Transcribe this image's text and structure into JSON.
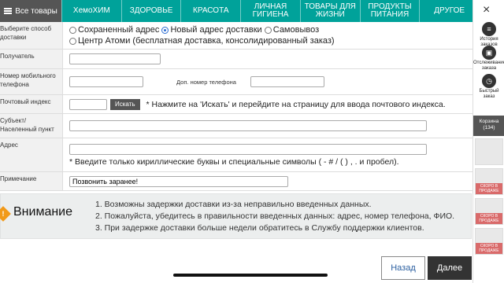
{
  "topnav": {
    "all_label": "Все товары",
    "categories": [
      "ХемоХИМ",
      "ЗДОРОВЬЕ",
      "КРАСОТА",
      "ЛИЧНАЯ ГИГИЕНА",
      "ТОВАРЫ ДЛЯ ЖИЗНИ",
      "ПРОДУКТЫ ПИТАНИЯ",
      "ДРУГОЕ"
    ]
  },
  "form": {
    "method": {
      "label": "Выберите способ доставки",
      "options": [
        "Сохраненный адрес",
        "Новый адрес доставки",
        "Самовывоз",
        "Центр Атоми (бесплатная доставка, консолидированный заказ)"
      ],
      "selected_index": 1
    },
    "recipient": {
      "label": "Получатель",
      "value": ""
    },
    "phone": {
      "label": "Номер мобильного телефона",
      "value": "",
      "extra_label": "Доп. номер телефона",
      "extra_value": ""
    },
    "postcode": {
      "label": "Почтовый индекс",
      "value": "",
      "search_label": "Искать",
      "note": "* Нажмите на 'Искать' и перейдите на страницу для ввода почтового индекса."
    },
    "locality": {
      "label": "Субъект/Населенный пункт",
      "value": ""
    },
    "address": {
      "label": "Адрес",
      "value": "",
      "note": "* Введите только кириллические буквы и специальные символы ( - # / ( ) , . и пробел)."
    },
    "comment": {
      "label": "Примечание",
      "value": "Позвонить заранее!"
    }
  },
  "attention": {
    "title": "Внимание",
    "items": [
      "1. Возможны задержки доставки из-за неправильно введенных данных.",
      "2. Пожалуйста, убедитесь в правильности введенных данных: адрес, номер телефона, ФИО.",
      "3. При задержке доставки больше недели обратитесь в Службу поддержки клиентов."
    ]
  },
  "buttons": {
    "back": "Назад",
    "next": "Далее"
  },
  "sidebar": {
    "close": "×",
    "history": "История заказов",
    "tracking": "Отслеживание заказа",
    "quick": "Быстрый заказ",
    "cart_label": "Корзина",
    "cart_count": "(134)",
    "ribbon": "СКОРО В ПРОДАЖЕ"
  },
  "colors": {
    "nav": "#00a29a",
    "dark": "#333333",
    "attention_bg": "#eceeee",
    "warn": "#f19a1a",
    "link": "#2b5fa0"
  }
}
